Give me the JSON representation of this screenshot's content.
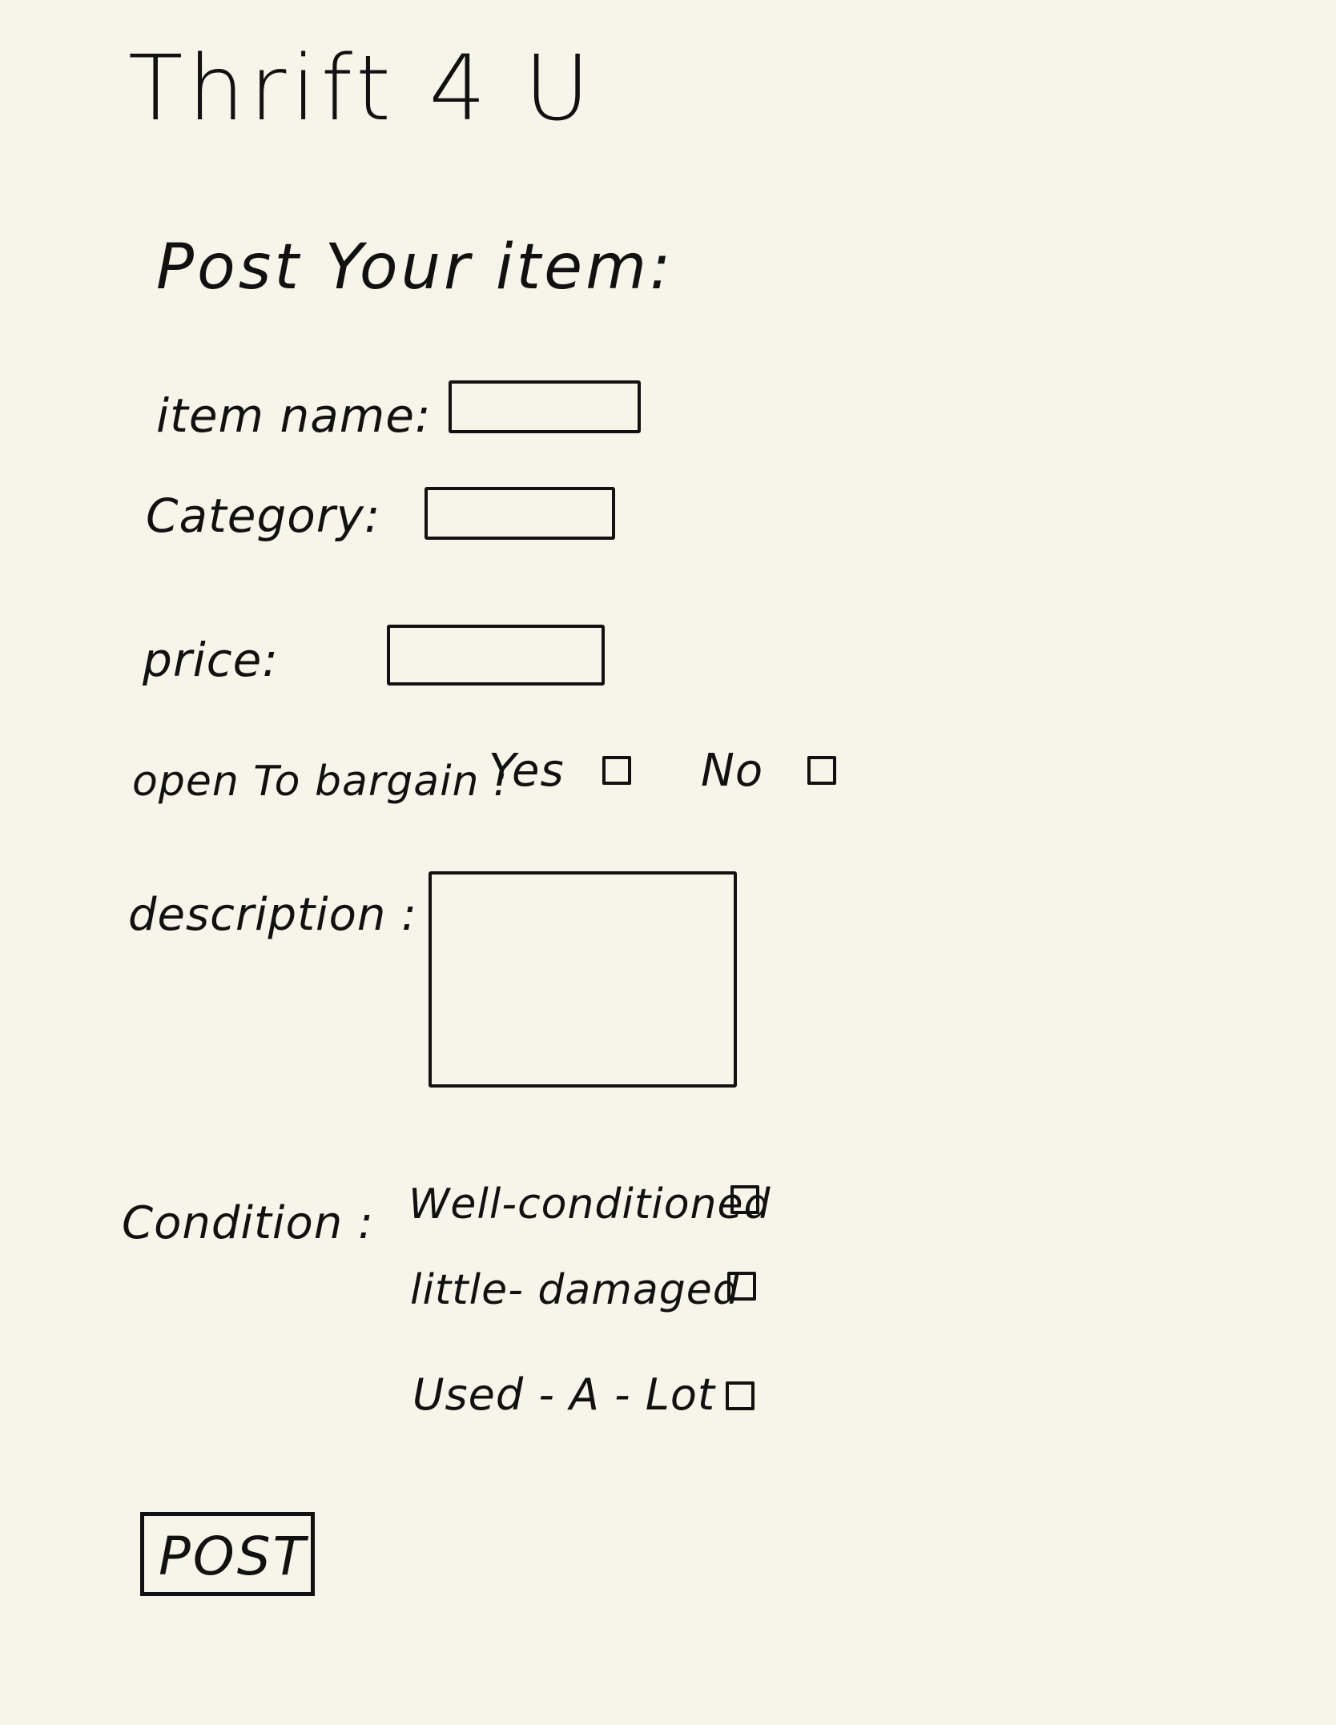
{
  "app": {
    "title": "Thrift 4 U"
  },
  "form": {
    "heading": "Post Your item:",
    "fields": {
      "item_name": {
        "label": "item name:",
        "value": ""
      },
      "category": {
        "label": "Category:",
        "value": ""
      },
      "price": {
        "label": "price:",
        "value": ""
      },
      "description": {
        "label": "description :",
        "value": ""
      }
    },
    "bargain": {
      "label": "open To bargain :",
      "options": [
        {
          "label": "Yes",
          "checked": false
        },
        {
          "label": "No",
          "checked": false
        }
      ]
    },
    "condition": {
      "label": "Condition :",
      "options": [
        {
          "label": "Well-conditioned",
          "checked": false
        },
        {
          "label": "little- damaged",
          "checked": false
        },
        {
          "label": "Used - A - Lot",
          "checked": false
        }
      ]
    },
    "submit_label": "POST"
  },
  "icons": {
    "checkbox": "empty-square-checkbox"
  }
}
